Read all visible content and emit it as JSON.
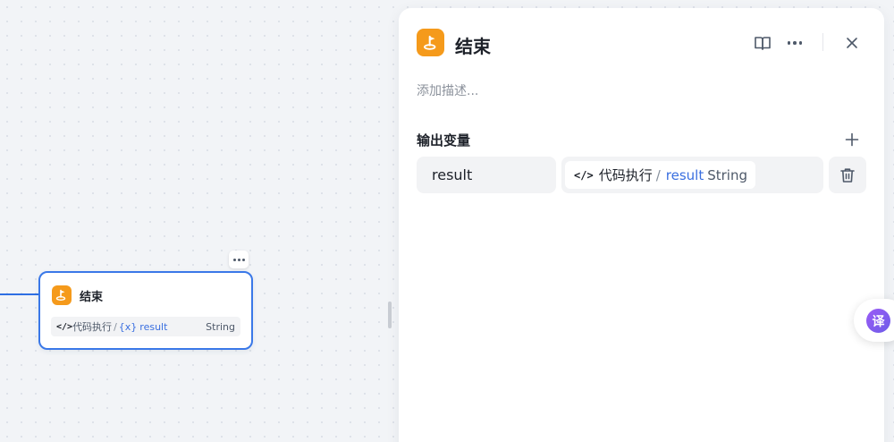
{
  "canvas": {
    "node": {
      "title": "结束",
      "output": {
        "source_icon": "code-icon",
        "source": "代码执行",
        "separator": "/",
        "var_prefix": "{x}",
        "variable": "result",
        "type": "String"
      }
    }
  },
  "panel": {
    "title": "结束",
    "description_placeholder": "添加描述...",
    "output_section_title": "输出变量",
    "outputs": [
      {
        "name": "result",
        "source": "代码执行",
        "separator": "/",
        "variable": "result",
        "type": "String"
      }
    ],
    "toolbar_icons": [
      "book-icon",
      "more-icon",
      "close-icon"
    ]
  },
  "floating": {
    "translate_label": "译"
  },
  "colors": {
    "accent": "#3a78e8",
    "node_icon_bg": "#f59a1b",
    "variable_text": "#3a6fe0"
  }
}
